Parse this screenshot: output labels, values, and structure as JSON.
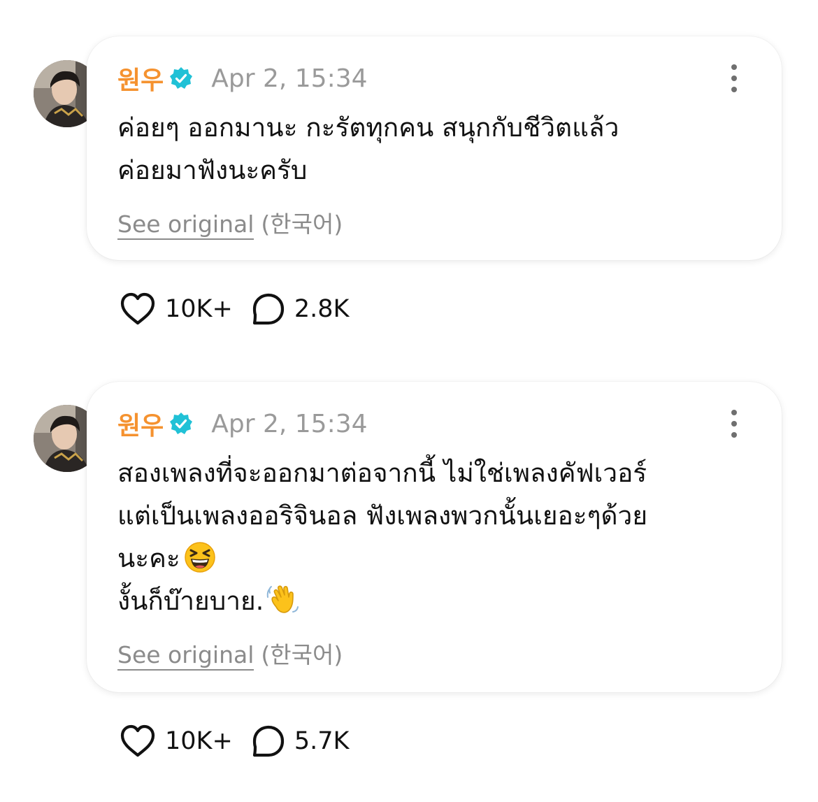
{
  "posts": [
    {
      "author": "원우",
      "time": "Apr 2, 15:34",
      "lines": [
        "ค่อยๆ ออกมานะ กะรัตทุกคน สนุกกับชีวิตแล้ว",
        "ค่อยมาฟังนะครับ"
      ],
      "see_original": "See original",
      "language": "(한국어)",
      "likes": "10K+",
      "comments": "2.8K"
    },
    {
      "author": "원우",
      "time": "Apr 2, 15:34",
      "lines": [
        "สองเพลงที่จะออกมาต่อจากนี้ ไม่ใช่เพลงคัฟเวอร์",
        "แต่เป็นเพลงออริจินอล ฟังเพลงพวกนั้นเยอะๆด้วย",
        "นะคะ",
        "งั้นก็บ๊ายบาย."
      ],
      "emojis": [
        "grinning-squinting-face",
        "waving-hand"
      ],
      "see_original": "See original",
      "language": "(한국어)",
      "likes": "10K+",
      "comments": "5.7K"
    }
  ],
  "colors": {
    "author": "#f5922f",
    "verified": "#20c1d6",
    "meta": "#9a9a9a",
    "text": "#111111"
  },
  "icons": {
    "verified": "verified-badge-icon",
    "more": "more-vertical-icon",
    "like": "heart-icon",
    "comment": "comment-bubble-icon"
  }
}
